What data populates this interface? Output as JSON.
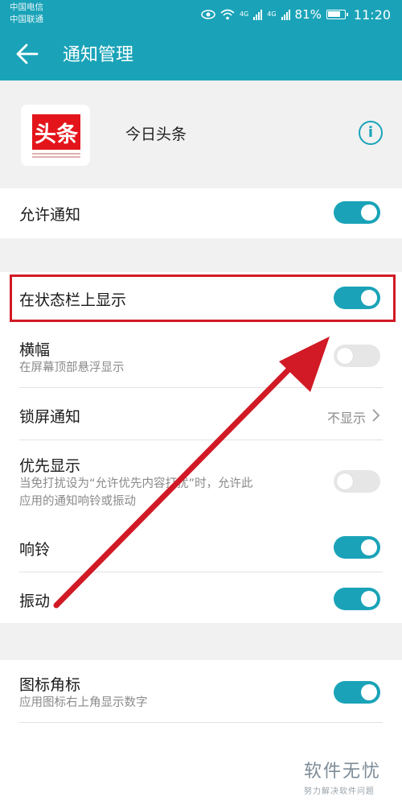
{
  "status_bar": {
    "carrier_1": "中国电信",
    "carrier_2": "中国联通",
    "network_1": "4G",
    "network_2": "4G",
    "battery": "81%",
    "battery_level": 0.81,
    "time": "11:20"
  },
  "app_bar": {
    "title": "通知管理",
    "accent_color": "#1aa3b8"
  },
  "app": {
    "logo_text": "头条",
    "name": "今日头条",
    "info_label": "i"
  },
  "settings": {
    "allow_notifications": {
      "label": "允许通知",
      "enabled": true
    },
    "status_bar_display": {
      "label": "在状态栏上显示",
      "enabled": true
    },
    "banner": {
      "label": "横幅",
      "description": "在屏幕顶部悬浮显示",
      "enabled": false
    },
    "lock_screen": {
      "label": "锁屏通知",
      "value": "不显示"
    },
    "priority": {
      "label": "优先显示",
      "description_line1": "当免打扰设为“允许优先内容打扰”时，允许此",
      "description_line2": "应用的通知响铃或振动",
      "enabled": false
    },
    "ring": {
      "label": "响铃",
      "enabled": true
    },
    "vibrate": {
      "label": "振动",
      "enabled": true
    },
    "badge": {
      "label": "图标角标",
      "description": "应用图标右上角显示数字",
      "enabled": true
    }
  },
  "watermark": {
    "title": "软件无忧",
    "subtitle": "努力解决软件问题"
  },
  "annotation_color": "#d11a25"
}
